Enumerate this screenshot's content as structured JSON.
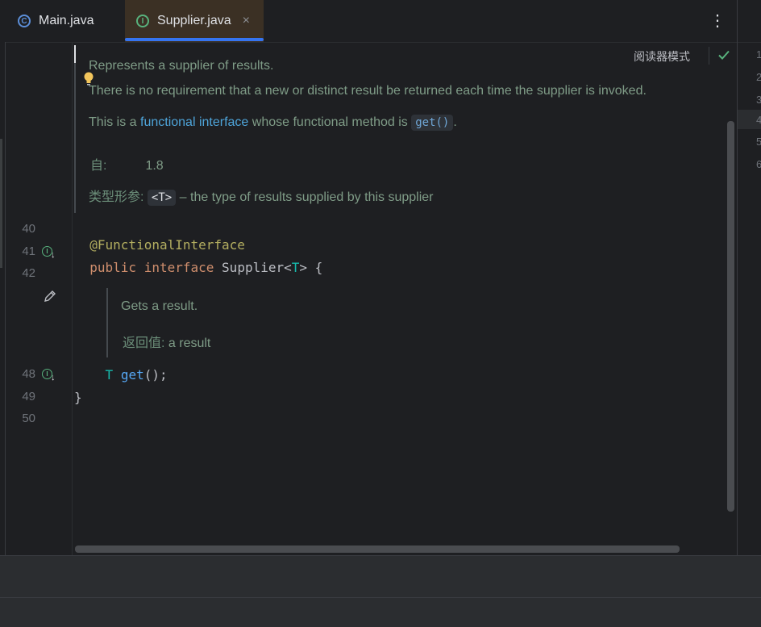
{
  "tabs": [
    {
      "icon": "class-c-icon",
      "label": "Main.java"
    },
    {
      "icon": "interface-i-icon",
      "label": "Supplier.java",
      "close": "×"
    }
  ],
  "more_menu": "⋮",
  "reader_mode": {
    "label": "阅读器模式"
  },
  "class_doc": {
    "line1": "Represents a supplier of results.",
    "line2": "There is no requirement that a new or distinct result be returned each time the supplier is invoked.",
    "line3_prefix": "This is a ",
    "line3_link": "functional interface",
    "line3_mid": " whose functional method is ",
    "line3_code": "get()",
    "line3_suffix": ".",
    "since_label": "自:",
    "since_value": "1.8",
    "typeparam_label": "类型形参:",
    "typeparam_code": "<T>",
    "typeparam_desc": " – the type of results supplied by this supplier"
  },
  "method_doc": {
    "line1": "Gets a result.",
    "returns_label": "返回值:",
    "returns_desc": " a result"
  },
  "line_numbers": {
    "l40": "40",
    "l41": "41",
    "l42": "42",
    "l48": "48",
    "l49": "49",
    "l50": "50"
  },
  "code": {
    "annotation": "@FunctionalInterface",
    "kw_public": "public",
    "kw_interface": "interface",
    "class_name": "Supplier<",
    "type_param": "T",
    "class_rest": "> {",
    "method_type": "T",
    "method_name": "get",
    "method_rest": "();",
    "closing_brace": "}"
  },
  "mini_line_numbers": [
    "1",
    "2",
    "3",
    "4",
    "5",
    "6"
  ],
  "colors": {
    "accent": "#3574f0",
    "doc_text": "#7f9c87",
    "keyword": "#cf8e6d",
    "annotation": "#b3ae60",
    "function": "#56a8f5"
  }
}
